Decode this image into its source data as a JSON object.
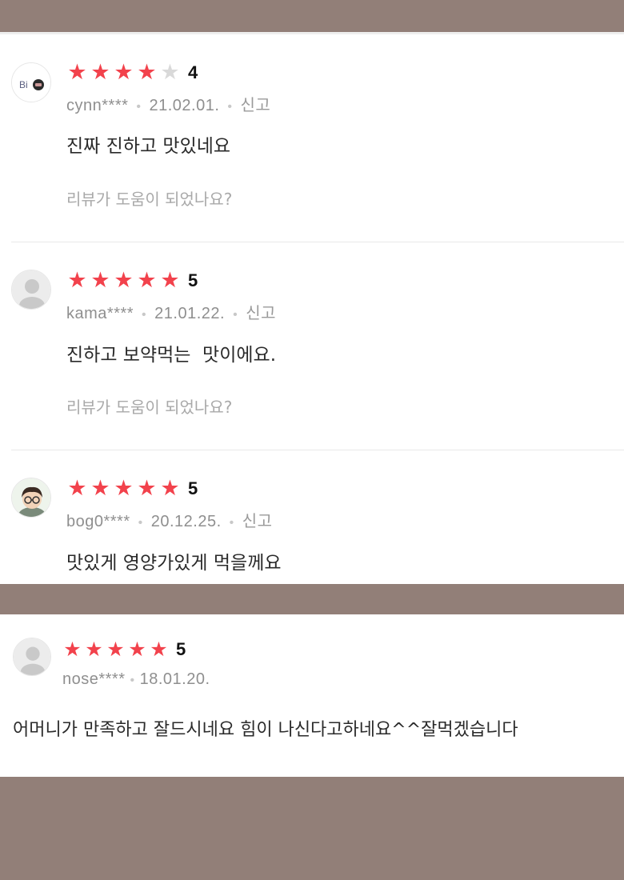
{
  "reviews": [
    {
      "avatar": "brand-logo-icon",
      "avatar_text": "Bi",
      "rating": 4,
      "stars": [
        true,
        true,
        true,
        true,
        false
      ],
      "rating_label": "4",
      "user": "cynn****",
      "date": "21.02.01.",
      "report": "신고",
      "content": "진짜 진하고 맛있네요",
      "helpful": "리뷰가 도움이 되었나요?"
    },
    {
      "avatar": "default-user-icon",
      "rating": 5,
      "stars": [
        true,
        true,
        true,
        true,
        true
      ],
      "rating_label": "5",
      "user": "kama****",
      "date": "21.01.22.",
      "report": "신고",
      "content": "진하고 보약먹는  맛이에요.",
      "helpful": "리뷰가 도움이 되었나요?"
    },
    {
      "avatar": "cartoon-avatar-icon",
      "rating": 5,
      "stars": [
        true,
        true,
        true,
        true,
        true
      ],
      "rating_label": "5",
      "user": "bog0****",
      "date": "20.12.25.",
      "report": "신고",
      "content": "맛있게 영양가있게 먹을께요"
    },
    {
      "avatar": "default-user-icon",
      "rating": 5,
      "stars": [
        true,
        true,
        true,
        true,
        true
      ],
      "rating_label": "5",
      "user": "nose****",
      "date": "18.01.20.",
      "content": "어머니가 만족하고 잘드시네요 힘이 나신다고하네요^^잘먹겠습니다"
    }
  ],
  "colors": {
    "star_on": "#f2424c",
    "star_off": "#d9d9d9",
    "background": "#927f78"
  }
}
